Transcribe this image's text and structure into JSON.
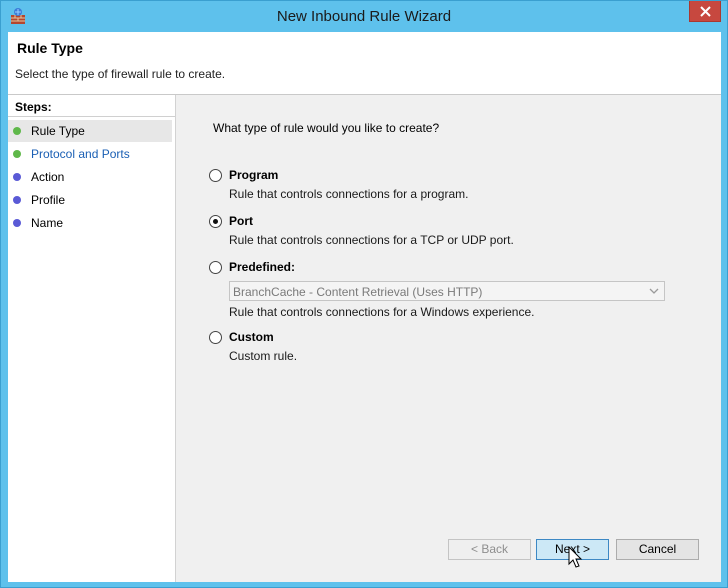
{
  "window": {
    "title": "New Inbound Rule Wizard"
  },
  "header": {
    "title": "Rule Type",
    "subtitle": "Select the type of firewall rule to create."
  },
  "steps": {
    "label": "Steps:",
    "items": [
      {
        "label": "Rule Type",
        "status": "current",
        "dot_color": "#5fb84a"
      },
      {
        "label": "Protocol and Ports",
        "status": "link",
        "dot_color": "#5fb84a"
      },
      {
        "label": "Action",
        "status": "pending",
        "dot_color": "#5a5ad6"
      },
      {
        "label": "Profile",
        "status": "pending",
        "dot_color": "#5a5ad6"
      },
      {
        "label": "Name",
        "status": "pending",
        "dot_color": "#5a5ad6"
      }
    ]
  },
  "main": {
    "question": "What type of rule would you like to create?",
    "options": [
      {
        "label": "Program",
        "description": "Rule that controls connections for a program.",
        "selected": false
      },
      {
        "label": "Port",
        "description": "Rule that controls connections for a TCP or UDP port.",
        "selected": true
      },
      {
        "label": "Predefined:",
        "description": "Rule that controls connections for a Windows experience.",
        "selected": false
      },
      {
        "label": "Custom",
        "description": "Custom rule.",
        "selected": false
      }
    ],
    "predefined_select": {
      "value": "BranchCache - Content Retrieval (Uses HTTP)"
    }
  },
  "buttons": {
    "back": "< Back",
    "next": "Next >",
    "cancel": "Cancel"
  },
  "colors": {
    "titlebar": "#5ec1ec",
    "close": "#c7483f",
    "link": "#1a5fb4"
  }
}
